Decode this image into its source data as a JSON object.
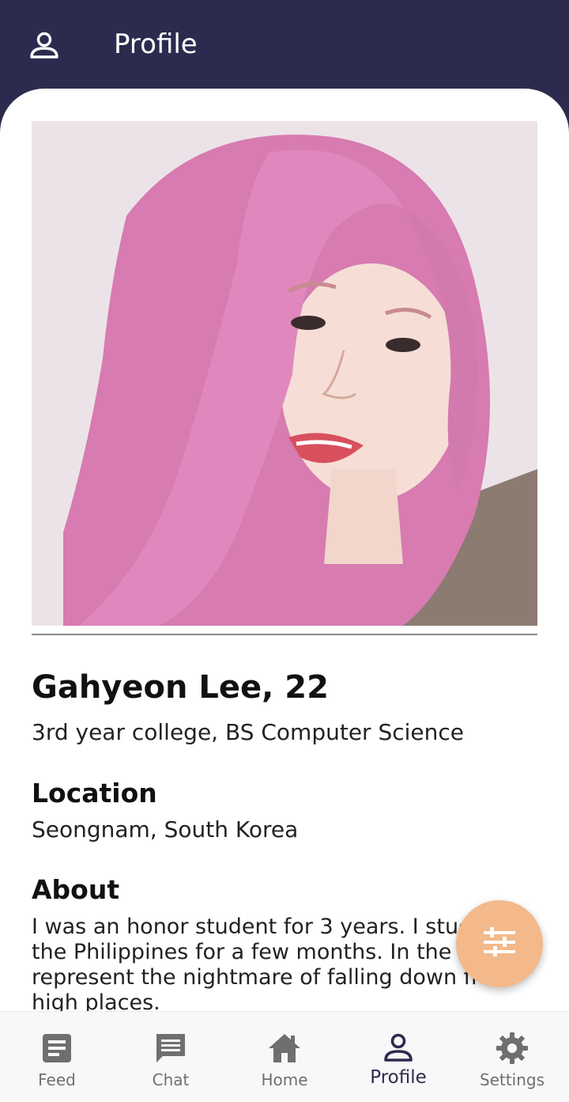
{
  "appbar": {
    "title": "Profile",
    "icon": "person-outline-icon"
  },
  "profile": {
    "name_age": "Gahyeon Lee, 22",
    "education": "3rd year college, BS Computer Science",
    "location_heading": "Location",
    "location": "Seongnam, South Korea",
    "about_heading": "About",
    "about": "I was an honor student for 3 years. I studied in the Philippines for a few months. In the group, I represent the nightmare of falling down from high places."
  },
  "fab": {
    "icon": "tune-sliders-icon",
    "color": "#f3b98a"
  },
  "bottom_nav": {
    "items": [
      {
        "label": "Feed",
        "icon": "article-icon"
      },
      {
        "label": "Chat",
        "icon": "chat-bubble-icon"
      },
      {
        "label": "Home",
        "icon": "home-icon"
      },
      {
        "label": "Profile",
        "icon": "person-outline-icon",
        "active": true
      },
      {
        "label": "Settings",
        "icon": "gear-icon"
      }
    ]
  },
  "colors": {
    "appbar": "#2c2b4f",
    "accent": "#f3b98a",
    "nav_inactive": "#6f6f6f",
    "nav_active": "#2c2b4f"
  }
}
